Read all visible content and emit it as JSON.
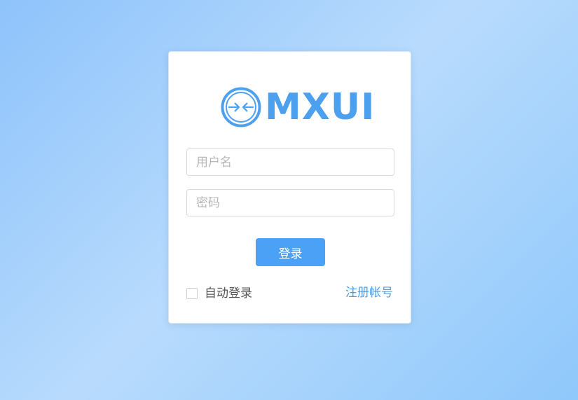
{
  "logo": {
    "text": "MXUI",
    "icon": "arrows-converge-circle-icon",
    "color": "#4da0ee"
  },
  "form": {
    "username_placeholder": "用户名",
    "username_value": "",
    "password_placeholder": "密码",
    "password_value": "",
    "login_label": "登录",
    "auto_login_label": "自动登录",
    "auto_login_checked": false,
    "register_label": "注册帐号"
  },
  "colors": {
    "accent": "#4aa1f5",
    "background_light": "#b8dbfd",
    "background_dark": "#8ec3fb"
  }
}
